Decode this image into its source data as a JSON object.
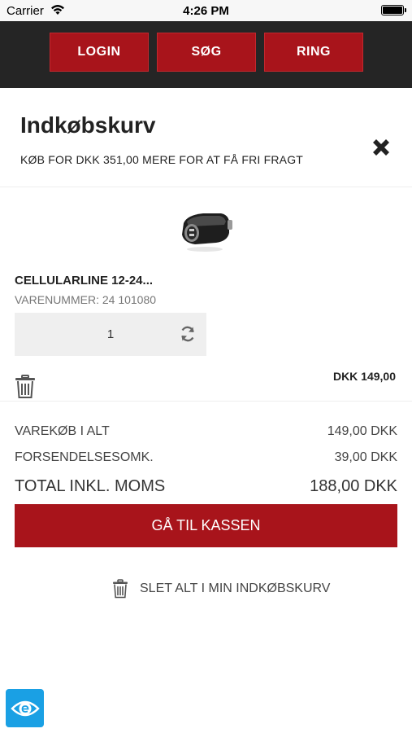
{
  "status_bar": {
    "carrier": "Carrier",
    "time": "4:26 PM"
  },
  "nav": {
    "login": "LOGIN",
    "search": "SØG",
    "call": "RING"
  },
  "cart": {
    "title": "Indkøbskurv",
    "free_shipping_notice": "KØB FOR DKK 351,00 MERE FOR AT FÅ FRI FRAGT"
  },
  "item": {
    "name": "CELLULARLINE 12-24...",
    "sku": "VARENUMMER: 24 101080",
    "quantity": "1",
    "price": "DKK 149,00"
  },
  "summary": {
    "subtotal_label": "VAREKØB I ALT",
    "subtotal_value": "149,00 DKK",
    "shipping_label": "FORSENDELSESOMK.",
    "shipping_value": "39,00 DKK",
    "total_label": "TOTAL INKL. MOMS",
    "total_value": "188,00 DKK"
  },
  "actions": {
    "checkout": "GÅ TIL KASSEN",
    "delete_all": "SLET ALT I MIN INDKØBSKURV"
  },
  "colors": {
    "brand_red": "#a8141b",
    "nav_bg": "#252525",
    "accessibility_blue": "#1aa0e4"
  },
  "icons": [
    "wifi-icon",
    "battery-icon",
    "close-icon",
    "refresh-icon",
    "trash-icon",
    "accessibility-icon"
  ]
}
